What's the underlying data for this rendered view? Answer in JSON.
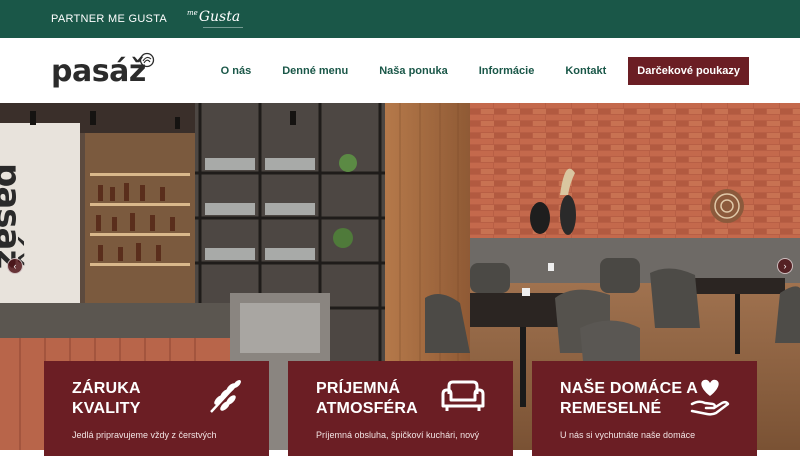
{
  "topbar": {
    "partner_label": "PARTNER ME GUSTA",
    "partner_logo_prefix": "me",
    "partner_logo_name": "Gusta"
  },
  "brand": {
    "logo_text": "pasáž"
  },
  "nav": {
    "items": [
      "O nás",
      "Denné menu",
      "Naša ponuka",
      "Informácie",
      "Kontakt"
    ],
    "cta": "Darčekové poukazy"
  },
  "hero": {
    "sign_text": "pasáž",
    "prev_arrow": "‹",
    "next_arrow": "›"
  },
  "features": [
    {
      "title": "ZÁRUKA KVALITY",
      "text": "Jedlá pripravujeme vždy z čerstvých",
      "icon": "wheat-icon"
    },
    {
      "title": "PRÍJEMNÁ ATMOSFÉRA",
      "text": "Príjemná obsluha, špičkoví kuchári, nový",
      "icon": "sofa-icon"
    },
    {
      "title": "NAŠE DOMÁCE A REMESELNÉ",
      "text": "U nás si vychutnáte naše domáce",
      "icon": "hand-heart-icon"
    }
  ],
  "colors": {
    "topbar": "#1a5748",
    "accent": "#6b1e24",
    "nav_text": "#1a5748"
  }
}
